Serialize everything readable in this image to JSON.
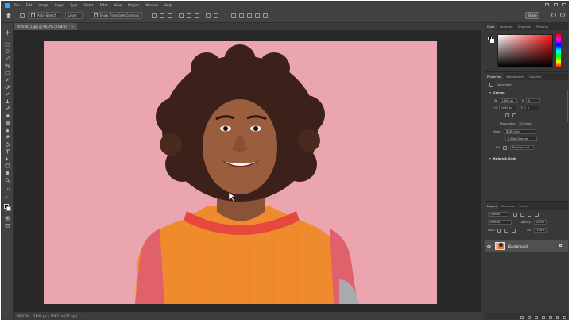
{
  "app": {
    "menu": [
      "File",
      "Edit",
      "Image",
      "Layer",
      "Type",
      "Select",
      "Filter",
      "View",
      "Plugins",
      "Window",
      "Help"
    ]
  },
  "options": {
    "auto_select_label": "Auto-Select:",
    "auto_select_value": "Layer",
    "show_transform_label": "Show Transform Controls",
    "share_label": "Share"
  },
  "document": {
    "tab_title": "Portrait_1.jpg @ 66.7% (RGB/8)",
    "close": "×"
  },
  "status": {
    "zoom": "66.67%",
    "size": "1600 px x 1067 px (72 ppi)",
    "arrow": "›"
  },
  "color_panel": {
    "tabs": [
      "Color",
      "Swatches",
      "Gradients",
      "Patterns"
    ],
    "active_tab": "Color"
  },
  "properties_panel": {
    "tabs": [
      "Properties",
      "Adjustments",
      "Libraries"
    ],
    "doc_type": "Document",
    "canvas_section": "Canvas",
    "width": "1600 px",
    "width_label": "W",
    "height": "1067 px",
    "height_label": "H",
    "x_label": "X",
    "x_value": "0",
    "y_label": "Y",
    "y_value": "0",
    "resolution_label": "Resolution:",
    "resolution_value": "300 pixel",
    "mode_label": "Mode",
    "mode_value": "RGB Color",
    "depth_value": "8 Bits/Channel",
    "fill_label": "Fill",
    "fill_value": "Background",
    "rulers_section": "Rulers & Grids"
  },
  "layers_panel": {
    "tabs": [
      "Layers",
      "Channels",
      "Paths"
    ],
    "kind_label": "Q Kind",
    "blend_mode": "Normal",
    "opacity_label": "Opacity:",
    "opacity_value": "100%",
    "lock_label": "Lock:",
    "fill_label": "Fill:",
    "fill_value": "100%",
    "layer_name": "Background"
  }
}
